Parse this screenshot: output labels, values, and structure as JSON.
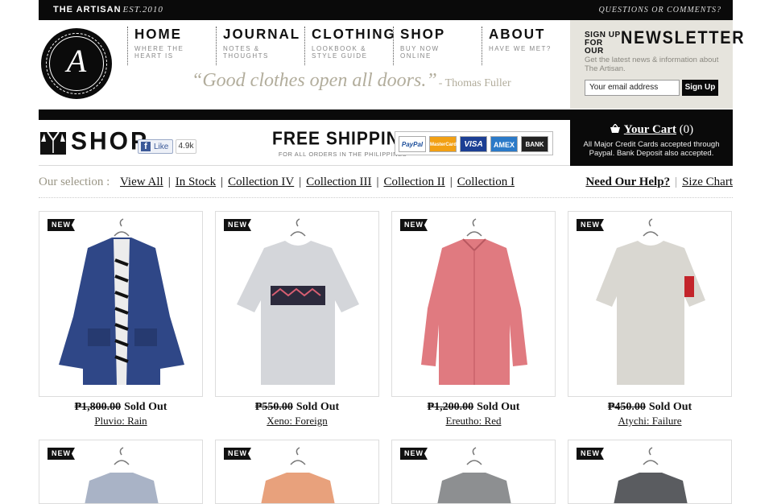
{
  "topbar": {
    "brand": "THE ARTISAN",
    "est": "EST.2010",
    "questions": "QUESTIONS OR COMMENTS?"
  },
  "logo": {
    "monogram": "A"
  },
  "nav": [
    {
      "title": "HOME",
      "sub": "WHERE THE HEART IS"
    },
    {
      "title": "JOURNAL",
      "sub": "NOTES & THOUGHTS"
    },
    {
      "title": "CLOTHING",
      "sub": "LOOKBOOK & STYLE GUIDE"
    },
    {
      "title": "SHOP",
      "sub": "BUY NOW ONLINE"
    },
    {
      "title": "ABOUT",
      "sub": "HAVE WE MET?"
    }
  ],
  "quote": {
    "text": "“Good clothes open all doors.”",
    "author": "- Thomas Fuller"
  },
  "newsletter": {
    "small": "SIGN UP FOR OUR",
    "big": "NEWSLETTER",
    "desc": "Get the latest news & information about The Artisan.",
    "placeholder": "Your email address",
    "button": "Sign Up"
  },
  "shopbar": {
    "title": "SHOP",
    "fb_like": "Like",
    "fb_count": "4.9k",
    "free_title": "FREE SHIPPING",
    "free_sub": "FOR ALL ORDERS IN THE PHILIPPINES",
    "payments": [
      "PayPal",
      "MasterCard",
      "VISA",
      "AMEX",
      "BANK"
    ]
  },
  "cart": {
    "label": "Your Cart",
    "count": "(0)",
    "note": "All Major Credit Cards accepted through Paypal. Bank Deposit also accepted."
  },
  "selection": {
    "label": "Our selection :",
    "links": [
      "View All",
      "In Stock",
      "Collection IV",
      "Collection III",
      "Collection II",
      "Collection I"
    ],
    "help": "Need Our Help?",
    "size_chart": "Size Chart"
  },
  "products": [
    {
      "tag": "NEW",
      "old_price": "₱1,800.00",
      "status": "Sold Out",
      "name": "Pluvio: Rain",
      "color": "#2f4787"
    },
    {
      "tag": "NEW",
      "old_price": "₱550.00",
      "status": "Sold Out",
      "name": "Xeno: Foreign",
      "color": "#d4d6da"
    },
    {
      "tag": "NEW",
      "old_price": "₱1,200.00",
      "status": "Sold Out",
      "name": "Ereutho: Red",
      "color": "#e07a80"
    },
    {
      "tag": "NEW",
      "old_price": "₱450.00",
      "status": "Sold Out",
      "name": "Atychi: Failure",
      "color": "#d9d7d1"
    },
    {
      "tag": "NEW",
      "color": "#a9b3c6"
    },
    {
      "tag": "NEW",
      "color": "#e8a17c"
    },
    {
      "tag": "NEW",
      "color": "#8d8f91"
    },
    {
      "tag": "NEW",
      "color": "#5a5c60"
    }
  ]
}
